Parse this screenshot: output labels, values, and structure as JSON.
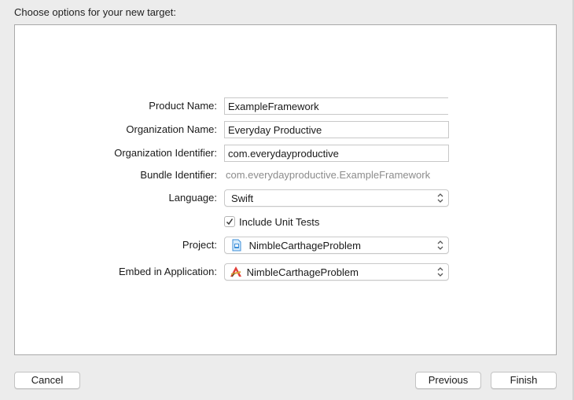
{
  "dialog": {
    "heading": "Choose options for your new target:"
  },
  "form": {
    "product_name": {
      "label": "Product Name:",
      "value": "ExampleFramework"
    },
    "organization_name": {
      "label": "Organization Name:",
      "value": "Everyday Productive"
    },
    "organization_identifier": {
      "label": "Organization Identifier:",
      "value": "com.everydayproductive"
    },
    "bundle_identifier": {
      "label": "Bundle Identifier:",
      "value": "com.everydayproductive.ExampleFramework"
    },
    "language": {
      "label": "Language:",
      "selected": "Swift"
    },
    "include_unit_tests": {
      "label": "Include Unit Tests",
      "checked": true
    },
    "project": {
      "label": "Project:",
      "selected": "NimbleCarthageProblem",
      "icon": "xcode-project-file-icon"
    },
    "embed_in_application": {
      "label": "Embed in Application:",
      "selected": "NimbleCarthageProblem",
      "icon": "app-target-icon"
    }
  },
  "buttons": {
    "cancel": "Cancel",
    "previous": "Previous",
    "finish": "Finish"
  }
}
